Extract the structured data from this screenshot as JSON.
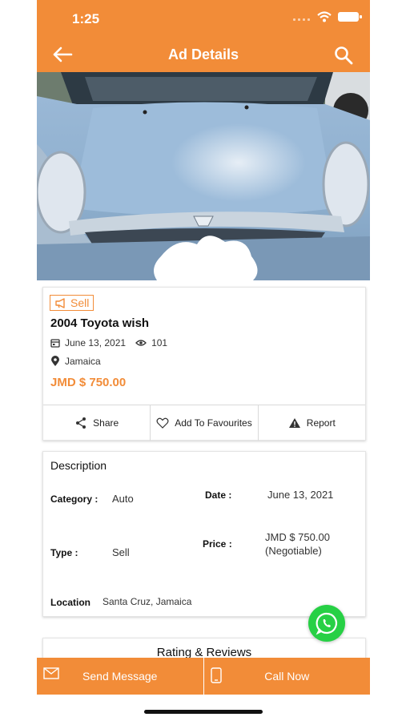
{
  "status": {
    "time": "1:25"
  },
  "header": {
    "title": "Ad Details"
  },
  "ad": {
    "badge": "Sell",
    "title": "2004 Toyota wish",
    "date": "June 13, 2021",
    "views": "101",
    "location": "Jamaica",
    "price": "JMD $ 750.00"
  },
  "actions": {
    "share": "Share",
    "favourite": "Add To Favourites",
    "report": "Report"
  },
  "description": {
    "title": "Description",
    "category_label": "Category :",
    "category_value": "Auto",
    "date_label": "Date :",
    "date_value": "June 13, 2021",
    "type_label": "Type :",
    "type_value": "Sell",
    "price_label": "Price :",
    "price_value_line1": "JMD $ 750.00",
    "price_value_line2": "(Negotiable)",
    "location_label": "Location",
    "location_value": "Santa Cruz, Jamaica"
  },
  "rating": {
    "title": "Rating & Reviews"
  },
  "bottom": {
    "message": "Send Message",
    "call": "Call Now"
  },
  "colors": {
    "accent": "#f28c38",
    "whatsapp": "#27d045"
  },
  "icons": [
    "back-arrow-icon",
    "search-icon",
    "megaphone-icon",
    "calendar-icon",
    "eye-icon",
    "location-pin-icon",
    "share-icon",
    "heart-icon",
    "warning-icon",
    "whatsapp-icon",
    "mail-icon",
    "phone-icon"
  ]
}
